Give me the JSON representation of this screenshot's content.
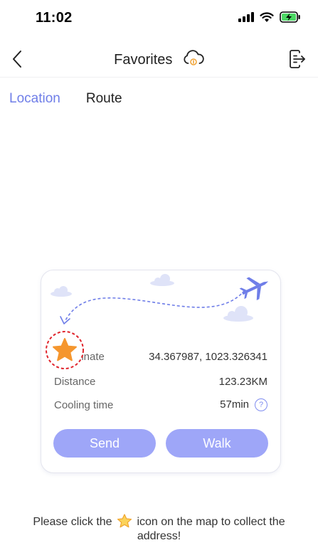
{
  "status_bar": {
    "time": "11:02",
    "signal_icon": "signal-bars-icon",
    "wifi_icon": "wifi-icon",
    "battery_icon": "battery-charging-icon"
  },
  "nav": {
    "title": "Favorites",
    "back_icon": "chevron-left-icon",
    "cloud_icon": "cloud-sync-icon",
    "export_icon": "export-icon"
  },
  "tabs": [
    {
      "label": "Location",
      "active": true
    },
    {
      "label": "Route",
      "active": false
    }
  ],
  "card": {
    "rows": [
      {
        "label": "Coordinate",
        "visible_label": "dinate",
        "value": "34.367987, 1023.326341"
      },
      {
        "label": "Distance",
        "value": "123.23KM"
      },
      {
        "label": "Cooling time",
        "value": "57min"
      }
    ],
    "help_glyph": "?",
    "buttons": {
      "send": "Send",
      "walk": "Walk"
    }
  },
  "hint": {
    "before": "Please click the",
    "after": "icon on the map to collect the address!"
  },
  "colors": {
    "accent": "#6f7ee8",
    "button": "#9ea6f8",
    "star": "#f5962e",
    "dashed_circle": "#e0242c",
    "cloud": "#dfe3f8"
  }
}
